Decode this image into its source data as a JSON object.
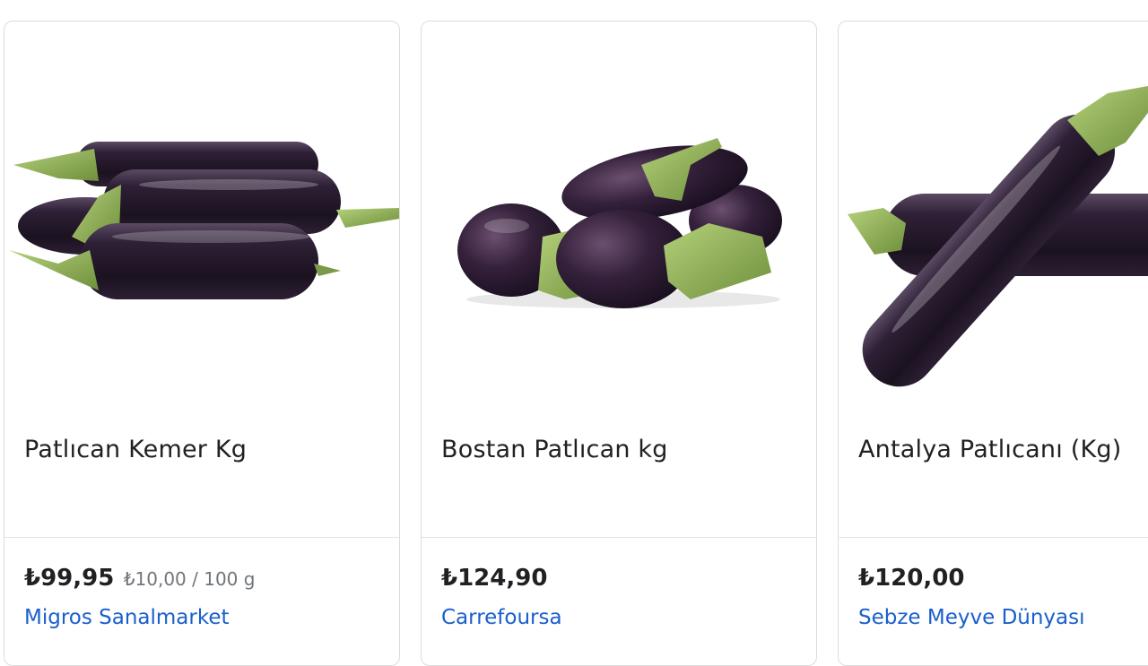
{
  "products": [
    {
      "title": "Patlıcan Kemer Kg",
      "price": "₺99,95",
      "unit_price": "₺10,00 / 100 g",
      "merchant": "Migros Sanalmarket",
      "image": "eggplant-bunch-image"
    },
    {
      "title": "Bostan Patlıcan kg",
      "price": "₺124,90",
      "unit_price": "",
      "merchant": "Carrefoursa",
      "image": "round-eggplants-image"
    },
    {
      "title": "Antalya Patlıcanı (Kg)",
      "price": "₺120,00",
      "unit_price": "",
      "merchant": "Sebze Meyve Dünyası",
      "image": "long-eggplants-image"
    }
  ],
  "colors": {
    "title_text": "#202124",
    "price_text": "#202124",
    "unit_price_text": "#70757a",
    "merchant_link": "#1a5fcc",
    "border": "#dadce0",
    "eggplant_skin": "#2a1a2e",
    "eggplant_stem": "#8fb15a"
  }
}
